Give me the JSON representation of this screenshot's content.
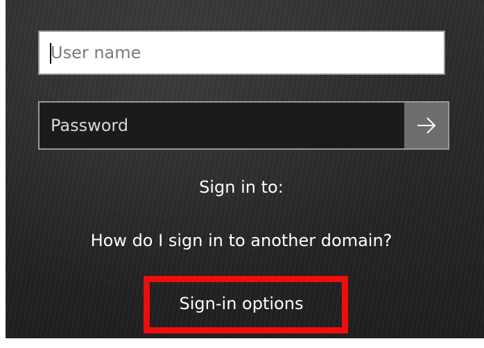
{
  "login": {
    "username_placeholder": "User name",
    "username_value": "",
    "password_placeholder": "Password",
    "password_value": "",
    "submit_icon": "arrow-right-icon"
  },
  "sign_in_to": {
    "label": "Sign in to:"
  },
  "links": {
    "domain_help": "How do I sign in to another domain?",
    "sign_in_options": "Sign-in options"
  },
  "colors": {
    "background": "#262626",
    "username_field_bg": "#ffffff",
    "password_field_bg": "#1b1b1b",
    "field_border": "#9a9a9a",
    "submit_button_bg": "#6d6d6d",
    "highlight_box": "#ef0d0d",
    "text": "#ffffff"
  }
}
